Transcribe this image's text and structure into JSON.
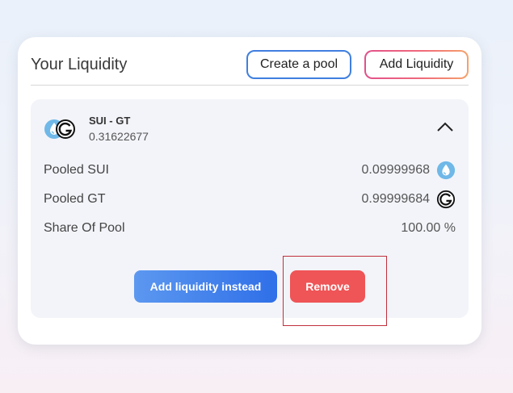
{
  "header": {
    "title": "Your Liquidity",
    "create_pool_label": "Create a pool",
    "add_liquidity_label": "Add Liquidity"
  },
  "pool": {
    "pair_name": "SUI - GT",
    "pair_amount": "0.31622677",
    "rows": [
      {
        "label": "Pooled SUI",
        "value": "0.09999968",
        "icon": "sui-token-icon"
      },
      {
        "label": "Pooled GT",
        "value": "0.99999684",
        "icon": "gt-token-icon"
      },
      {
        "label": "Share Of Pool",
        "value": "100.00 %"
      }
    ],
    "add_instead_label": "Add liquidity instead",
    "remove_label": "Remove"
  },
  "colors": {
    "sui_blue": "#6fb8e8",
    "primary_blue": "#3f7fe0",
    "remove_red": "#ef5456",
    "highlight_red": "#c0303c"
  }
}
